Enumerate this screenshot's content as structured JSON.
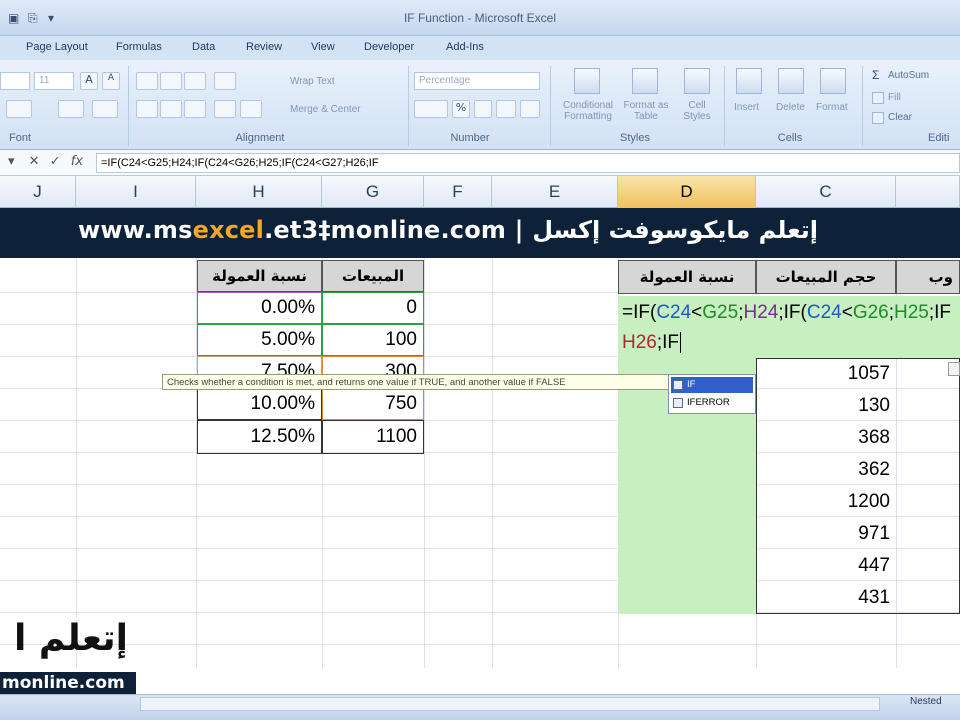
{
  "window": {
    "title": "IF Function - Microsoft Excel"
  },
  "ribbon": {
    "tabs": [
      "Page Layout",
      "Formulas",
      "Data",
      "Review",
      "View",
      "Developer",
      "Add-Ins"
    ],
    "font_size": "11",
    "wrap_text": "Wrap Text",
    "merge_center": "Merge & Center",
    "number_format": "Percentage",
    "conditional_formatting": "Conditional Formatting",
    "format_as_table": "Format as Table",
    "cell_styles": "Cell Styles",
    "insert": "Insert",
    "delete": "Delete",
    "format": "Format",
    "autosum": "AutoSum",
    "fill": "Fill",
    "clear": "Clear",
    "groups": [
      "Font",
      "Alignment",
      "Number",
      "Styles",
      "Cells",
      "Editi"
    ]
  },
  "formula_bar": {
    "content": "=IF(C24<G25;H24;IF(C24<G26;H25;IF(C24<G27;H26;IF"
  },
  "columns": [
    "J",
    "I",
    "H",
    "G",
    "F",
    "E",
    "D",
    "C"
  ],
  "banner": {
    "url_prefix": "www.ms",
    "url_accent": "excel",
    "url_suffix": ".et3‡monline.com",
    "separator": " | ",
    "arabic": "إتعلم مايكوسوفت إكسل"
  },
  "lookup_table": {
    "headers": [
      "نسبة العمولة",
      "المبيعات"
    ],
    "rows": [
      [
        "0.00%",
        "0"
      ],
      [
        "5.00%",
        "100"
      ],
      [
        "7.50%",
        "300"
      ],
      [
        "10.00%",
        "750"
      ],
      [
        "12.50%",
        "1100"
      ]
    ]
  },
  "sales_table": {
    "headers": [
      "نسبة العمولة",
      "حجم المبيعات",
      "وب"
    ],
    "sales": [
      "1057",
      "130",
      "368",
      "362",
      "1200",
      "971",
      "447",
      "431"
    ]
  },
  "cell_edit": {
    "line1_parts": [
      "=IF(",
      "C24",
      "<",
      "G25",
      ";",
      "H24",
      ";IF(",
      "C24",
      "<",
      "G26",
      ";",
      "H25",
      ";IF"
    ],
    "line2_parts": [
      "H26",
      ";IF"
    ]
  },
  "tooltip": {
    "text": "Checks whether a condition is met, and returns one value if TRUE, and another value if FALSE"
  },
  "autocomplete": {
    "items": [
      "IF",
      "IFERROR"
    ]
  },
  "watermark": {
    "arabic": "إتعلم ا",
    "url": "monline.com"
  },
  "sheet_tab": "Nested"
}
